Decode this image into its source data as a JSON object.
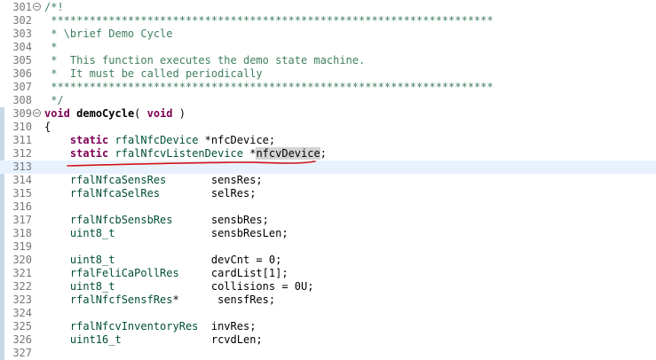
{
  "editor": {
    "lines": [
      {
        "n": "301",
        "fold": "minus",
        "parts": [
          {
            "t": "/*!",
            "c": "cm"
          }
        ]
      },
      {
        "n": "302",
        "parts": [
          {
            "t": " *********************************************************************",
            "c": "cm"
          }
        ]
      },
      {
        "n": "303",
        "parts": [
          {
            "t": " * \\brief Demo Cycle",
            "c": "cm"
          }
        ]
      },
      {
        "n": "304",
        "parts": [
          {
            "t": " *",
            "c": "cm"
          }
        ]
      },
      {
        "n": "305",
        "parts": [
          {
            "t": " *  This function executes the demo state machine.",
            "c": "cm"
          }
        ]
      },
      {
        "n": "306",
        "parts": [
          {
            "t": " *  It must be called periodically",
            "c": "cm"
          }
        ]
      },
      {
        "n": "307",
        "parts": [
          {
            "t": " *********************************************************************",
            "c": "cm"
          }
        ]
      },
      {
        "n": "308",
        "parts": [
          {
            "t": " */",
            "c": "cm"
          }
        ]
      },
      {
        "n": "309",
        "fold": "minus",
        "parts": [
          {
            "t": "void",
            "c": "kw"
          },
          {
            "t": " "
          },
          {
            "t": "demoCycle",
            "c": "fn"
          },
          {
            "t": "( "
          },
          {
            "t": "void",
            "c": "kw"
          },
          {
            "t": " )"
          }
        ]
      },
      {
        "n": "310",
        "parts": [
          {
            "t": "{"
          }
        ]
      },
      {
        "n": "311",
        "parts": [
          {
            "t": "    "
          },
          {
            "t": "static",
            "c": "kw"
          },
          {
            "t": " "
          },
          {
            "t": "rfalNfcDevice",
            "c": "ty"
          },
          {
            "t": " *nfcDevice;"
          }
        ]
      },
      {
        "n": "312",
        "parts": [
          {
            "t": "    "
          },
          {
            "t": "static",
            "c": "kw"
          },
          {
            "t": " "
          },
          {
            "t": "rfalNfcvListenDevice",
            "c": "ty"
          },
          {
            "t": " *"
          },
          {
            "t": "nfcvDevice",
            "c": "hl"
          },
          {
            "t": ";"
          }
        ]
      },
      {
        "n": "313",
        "current": true,
        "parts": []
      },
      {
        "n": "314",
        "parts": [
          {
            "t": "    "
          },
          {
            "t": "rfalNfcaSensRes",
            "c": "ty"
          },
          {
            "t": "       sensRes;"
          }
        ]
      },
      {
        "n": "315",
        "parts": [
          {
            "t": "    "
          },
          {
            "t": "rfalNfcaSelRes",
            "c": "ty"
          },
          {
            "t": "        selRes;"
          }
        ]
      },
      {
        "n": "316",
        "parts": []
      },
      {
        "n": "317",
        "parts": [
          {
            "t": "    "
          },
          {
            "t": "rfalNfcbSensbRes",
            "c": "ty"
          },
          {
            "t": "      sensbRes;"
          }
        ]
      },
      {
        "n": "318",
        "parts": [
          {
            "t": "    "
          },
          {
            "t": "uint8_t",
            "c": "ty"
          },
          {
            "t": "               sensbResLen;"
          }
        ]
      },
      {
        "n": "319",
        "parts": []
      },
      {
        "n": "320",
        "parts": [
          {
            "t": "    "
          },
          {
            "t": "uint8_t",
            "c": "ty"
          },
          {
            "t": "               devCnt = 0;"
          }
        ]
      },
      {
        "n": "321",
        "parts": [
          {
            "t": "    "
          },
          {
            "t": "rfalFeliCaPollRes",
            "c": "ty"
          },
          {
            "t": "     cardList[1];"
          }
        ]
      },
      {
        "n": "322",
        "parts": [
          {
            "t": "    "
          },
          {
            "t": "uint8_t",
            "c": "ty"
          },
          {
            "t": "               collisions = 0U;"
          }
        ]
      },
      {
        "n": "323",
        "parts": [
          {
            "t": "    "
          },
          {
            "t": "rfalNfcfSensfRes",
            "c": "ty"
          },
          {
            "t": "*      sensfRes;"
          }
        ]
      },
      {
        "n": "324",
        "parts": []
      },
      {
        "n": "325",
        "parts": [
          {
            "t": "    "
          },
          {
            "t": "rfalNfcvInventoryRes",
            "c": "ty"
          },
          {
            "t": "  invRes;"
          }
        ]
      },
      {
        "n": "326",
        "parts": [
          {
            "t": "    "
          },
          {
            "t": "uint16_t",
            "c": "ty"
          },
          {
            "t": "              rcvdLen;"
          }
        ]
      },
      {
        "n": "327",
        "parts": []
      }
    ],
    "colors": {
      "comment": "#3f7f5f",
      "keyword": "#7f0055",
      "type": "#005032",
      "current_line": "#e8f2fe",
      "occurrence_highlight": "#d4d4d4",
      "annotation_underline": "#d21414"
    },
    "fold_glyph": "−"
  }
}
